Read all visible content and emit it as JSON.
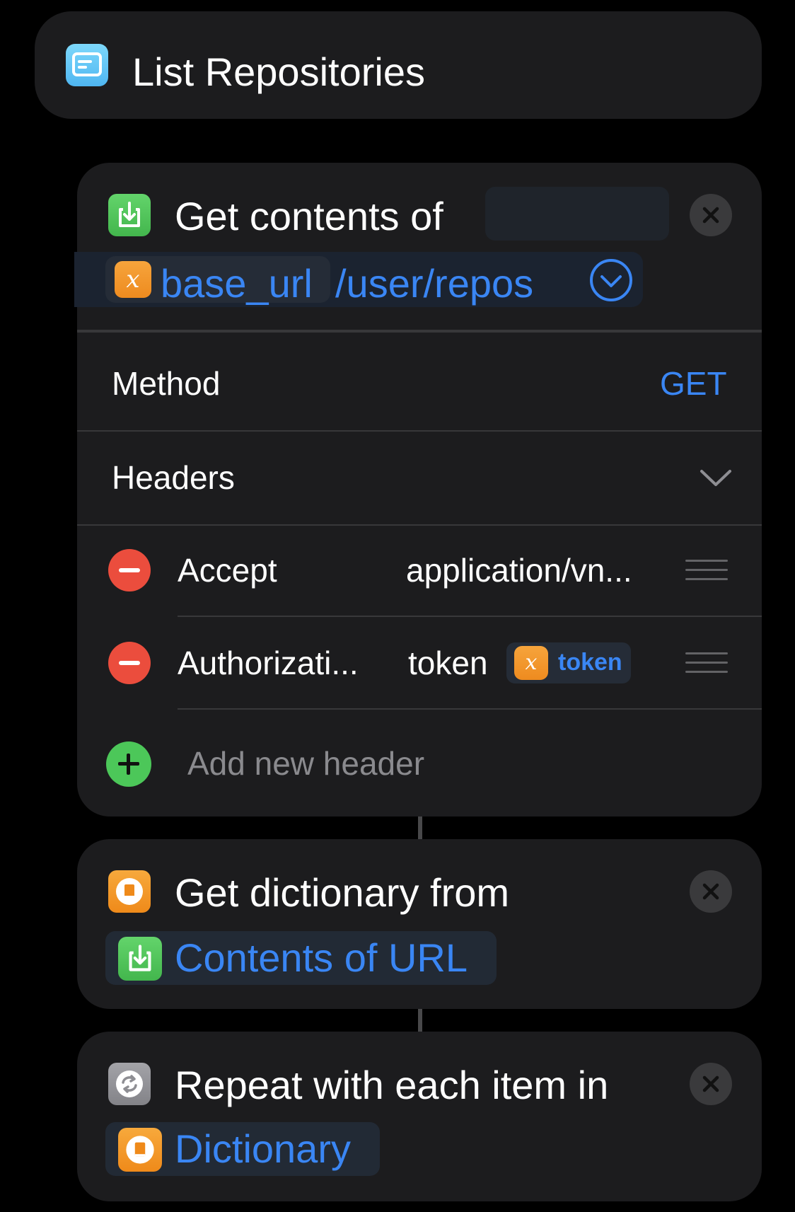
{
  "header": {
    "title": "List Repositories",
    "icon": "text-list-icon"
  },
  "actions": {
    "get_contents": {
      "label": "Get contents of",
      "url_variable": "base_url",
      "url_path": "/user/repos",
      "method_label": "Method",
      "method_value": "GET",
      "headers_label": "Headers",
      "headers": [
        {
          "key": "Accept",
          "value": "application/vn..."
        },
        {
          "key": "Authorizati...",
          "value_text": "token",
          "value_variable": "token"
        }
      ],
      "add_header_placeholder": "Add new header"
    },
    "get_dictionary": {
      "label": "Get dictionary from",
      "input": "Contents of URL"
    },
    "repeat": {
      "label": "Repeat with each item in",
      "input": "Dictionary"
    }
  },
  "variable_glyph": "x",
  "colors": {
    "background": "#000000",
    "card": "#1c1c1e",
    "accent": "#3a86f4",
    "variable": "#f29c2f",
    "download": "#4fc35a",
    "delete": "#eb4d3d"
  }
}
